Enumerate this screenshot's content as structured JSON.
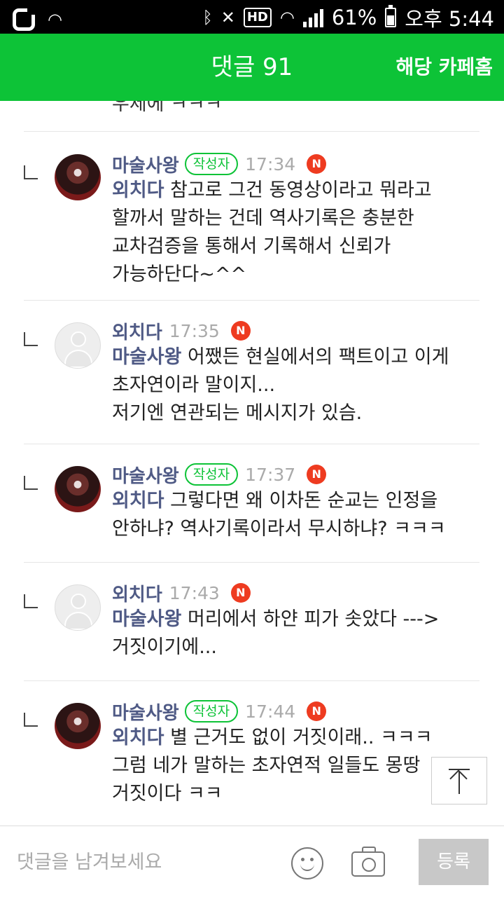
{
  "status_bar": {
    "battery": "61%",
    "clock": "오후 5:44",
    "hd_label": "HD",
    "icons": [
      "carrier-logo-icon",
      "wifi-icon",
      "bluetooth-icon",
      "mute-icon",
      "hd-voice-icon",
      "wifi-data-icon",
      "signal-icon",
      "battery-icon"
    ]
  },
  "header": {
    "title": "댓글 91",
    "cafe_home_link": "해당 카페홈",
    "background_color": "#0dc337"
  },
  "partial_top_text": "우제에 ㅋㅋㅋ",
  "comments": [
    {
      "author": "마술사왕",
      "is_writer": true,
      "badge": "작성자",
      "time": "17:34",
      "new": "N",
      "avatar": "character-avatar",
      "mention": "외치다",
      "lines": [
        " 참고로 그건 동영상이라고 뭐라고",
        "할까서 말하는 건데 역사기록은 충분한",
        "교차검증을 통해서 기록해서 신뢰가",
        "가능하단다~^^"
      ]
    },
    {
      "author": "외치다",
      "is_writer": false,
      "time": "17:35",
      "new": "N",
      "avatar": "default-avatar",
      "mention": "마술사왕",
      "lines": [
        " 어쨌든 현실에서의 팩트이고 이게",
        "초자연이라 말이지...",
        "저기엔 연관되는 메시지가 있슴."
      ]
    },
    {
      "author": "마술사왕",
      "is_writer": true,
      "badge": "작성자",
      "time": "17:37",
      "new": "N",
      "avatar": "character-avatar",
      "mention": "외치다",
      "lines": [
        " 그렇다면 왜 이차돈 순교는 인정을",
        "안하냐? 역사기록이라서 무시하냐? ㅋㅋㅋ"
      ]
    },
    {
      "author": "외치다",
      "is_writer": false,
      "time": "17:43",
      "new": "N",
      "avatar": "default-avatar",
      "mention": "마술사왕",
      "lines": [
        " 머리에서 하얀 피가 솟았다 --->",
        "거짓이기에..."
      ]
    },
    {
      "author": "마술사왕",
      "is_writer": true,
      "badge": "작성자",
      "time": "17:44",
      "new": "N",
      "avatar": "character-avatar",
      "mention": "외치다",
      "lines": [
        " 별 근거도 없이 거짓이래.. ㅋㅋㅋ",
        "그럼 네가 말하는 초자연적 일들도 몽땅",
        "거짓이다 ㅋㅋ"
      ]
    }
  ],
  "input_bar": {
    "placeholder": "댓글을 남겨보세요",
    "value": "",
    "submit_label": "등록"
  },
  "colors": {
    "accent": "#0dc337",
    "author": "#4f5a85",
    "new_badge": "#ee3b20"
  }
}
